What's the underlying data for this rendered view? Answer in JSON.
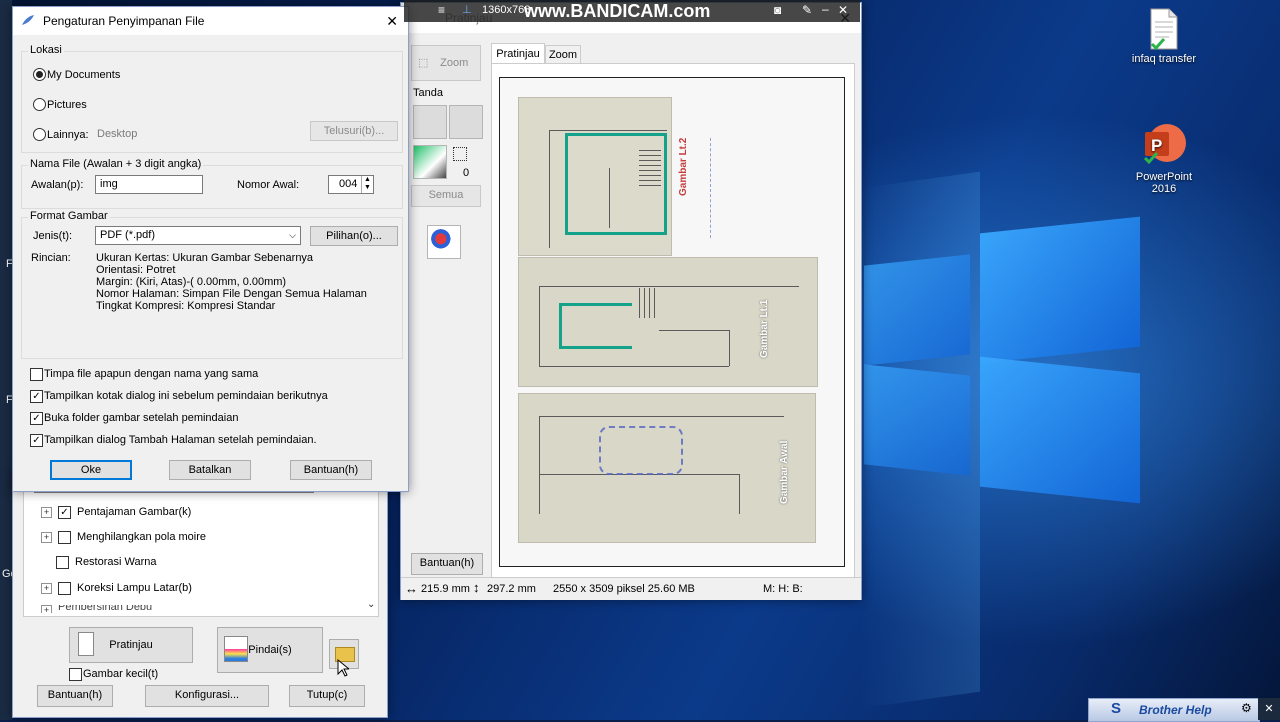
{
  "desktop": {
    "icons": [
      {
        "label": "infaq transfer",
        "icon": "document-icon"
      },
      {
        "label": "PowerPoint\n2016",
        "icon": "powerpoint-icon"
      }
    ],
    "left_edge_labels": [
      "F",
      "F",
      "Go"
    ]
  },
  "recorder_bar": {
    "resolution": "1360x768",
    "watermark": "www.BANDICAM.com"
  },
  "save_dialog": {
    "title": "Pengaturan Penyimpanan File",
    "location": {
      "group_title": "Lokasi",
      "options": [
        "My Documents",
        "Pictures",
        "Lainnya:"
      ],
      "selected": "My Documents",
      "other_value": "Desktop",
      "browse_label": "Telusuri(b)..."
    },
    "filename": {
      "group_title": "Nama File (Awalan + 3 digit angka)",
      "prefix_label": "Awalan(p):",
      "prefix_value": "img",
      "start_number_label": "Nomor Awal:",
      "start_number_value": "004"
    },
    "format": {
      "group_title": "Format Gambar",
      "type_label": "Jenis(t):",
      "type_value": "PDF (*.pdf)",
      "options_label": "Pilihan(o)...",
      "details_label": "Rincian:",
      "details": [
        "Ukuran Kertas: Ukuran Gambar Sebenarnya",
        "Orientasi: Potret",
        "Margin: (Kiri, Atas)-( 0.00mm, 0.00mm)",
        "Nomor Halaman: Simpan File Dengan Semua Halaman",
        "Tingkat Kompresi: Kompresi Standar"
      ]
    },
    "checkboxes": [
      {
        "label": "Timpa file apapun dengan nama yang sama",
        "checked": false
      },
      {
        "label": "Tampilkan kotak dialog ini sebelum pemindaian berikutnya",
        "checked": true
      },
      {
        "label": "Buka folder gambar setelah pemindaian",
        "checked": true
      },
      {
        "label": "Tampilkan dialog Tambah Halaman setelah pemindaian.",
        "checked": true
      }
    ],
    "ok_label": "Oke",
    "cancel_label": "Batalkan",
    "help_label": "Bantuan(h)"
  },
  "scan_window": {
    "tree_items": [
      {
        "label": "Pentajaman Gambar(k)",
        "expandable": true,
        "checked": true
      },
      {
        "label": "Menghilangkan pola moire",
        "expandable": true,
        "checked": false
      },
      {
        "label": "Restorasi Warna",
        "expandable": false,
        "checked": false
      },
      {
        "label": "Koreksi Lampu Latar(b)",
        "expandable": true,
        "checked": false
      },
      {
        "label": "Pembersihan Debu",
        "expandable": true,
        "checked": false
      }
    ],
    "preview_label": "Pratinjau",
    "scan_label": "Pindai(s)",
    "thumbnail_label": "Gambar kecil(t)",
    "help_label": "Bantuan(h)",
    "config_label": "Konfigurasi...",
    "close_label": "Tutup(c)"
  },
  "preview_window": {
    "title": "Pratinjau",
    "zoom_label": "Zoom",
    "mark_label": "Tanda",
    "all_label": "Semua",
    "count": "0",
    "tabs": [
      "Pratinjau",
      "Zoom"
    ],
    "active_tab": "Pratinjau",
    "help_label": "Bantuan(h)",
    "status": {
      "width": "215.9 mm",
      "height": "297.2 mm",
      "info": "2550 x 3509 piksel 25.60 MB",
      "mhb": "M: H: B:"
    },
    "plans": [
      "Gambar Lt.2",
      "Gambar Lt.1",
      "Gambar Awal"
    ]
  },
  "taskbar_popup": {
    "label": "Brother Help"
  },
  "colors": {
    "accent": "#0078d7",
    "teal_wall": "#14a38a",
    "desktop": "#0b3a8a"
  }
}
